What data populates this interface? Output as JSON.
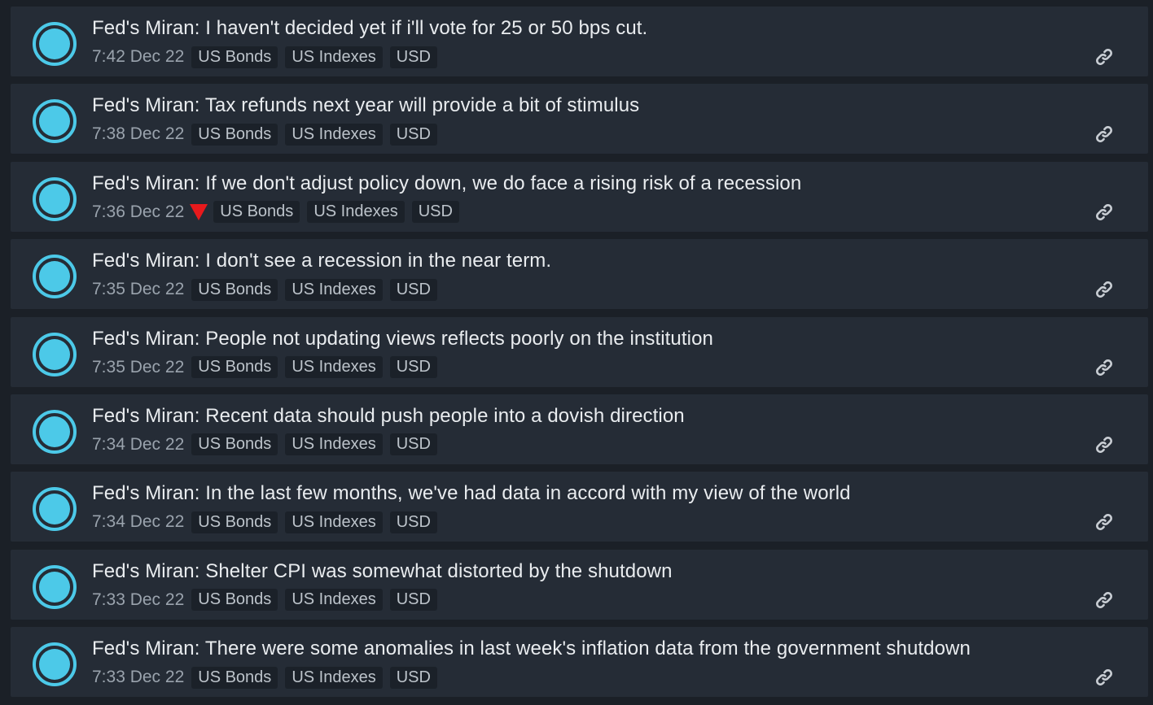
{
  "colors": {
    "background": "#1b2027",
    "card": "#252c36",
    "accent": "#4cc9e8",
    "down_indicator": "#e8191c"
  },
  "feed": {
    "items": [
      {
        "headline": "Fed's Miran: I haven't decided yet if i'll vote for 25 or 50 bps cut.",
        "time": "7:42 Dec 22",
        "indicator": "none",
        "tags": [
          "US Bonds",
          "US Indexes",
          "USD"
        ]
      },
      {
        "headline": "Fed's Miran: Tax refunds next year will provide a bit of stimulus",
        "time": "7:38 Dec 22",
        "indicator": "none",
        "tags": [
          "US Bonds",
          "US Indexes",
          "USD"
        ]
      },
      {
        "headline": "Fed's Miran: If we don't adjust policy down, we do face a rising risk of a recession",
        "time": "7:36 Dec 22",
        "indicator": "down-triangle-icon",
        "tags": [
          "US Bonds",
          "US Indexes",
          "USD"
        ]
      },
      {
        "headline": "Fed's Miran: I don't see a recession in the near term.",
        "time": "7:35 Dec 22",
        "indicator": "none",
        "tags": [
          "US Bonds",
          "US Indexes",
          "USD"
        ]
      },
      {
        "headline": "Fed's Miran: People not updating views reflects poorly on the institution",
        "time": "7:35 Dec 22",
        "indicator": "none",
        "tags": [
          "US Bonds",
          "US Indexes",
          "USD"
        ]
      },
      {
        "headline": "Fed's Miran: Recent data should push people into a dovish direction",
        "time": "7:34 Dec 22",
        "indicator": "none",
        "tags": [
          "US Bonds",
          "US Indexes",
          "USD"
        ]
      },
      {
        "headline": "Fed's Miran: In the last few months, we've had data in accord with my view of the world",
        "time": "7:34 Dec 22",
        "indicator": "none",
        "tags": [
          "US Bonds",
          "US Indexes",
          "USD"
        ]
      },
      {
        "headline": "Fed's Miran: Shelter CPI was somewhat distorted by the shutdown",
        "time": "7:33 Dec 22",
        "indicator": "none",
        "tags": [
          "US Bonds",
          "US Indexes",
          "USD"
        ]
      },
      {
        "headline": "Fed's Miran: There were some anomalies in last week's inflation data from the government shutdown",
        "time": "7:33 Dec 22",
        "indicator": "none",
        "tags": [
          "US Bonds",
          "US Indexes",
          "USD"
        ]
      }
    ]
  }
}
